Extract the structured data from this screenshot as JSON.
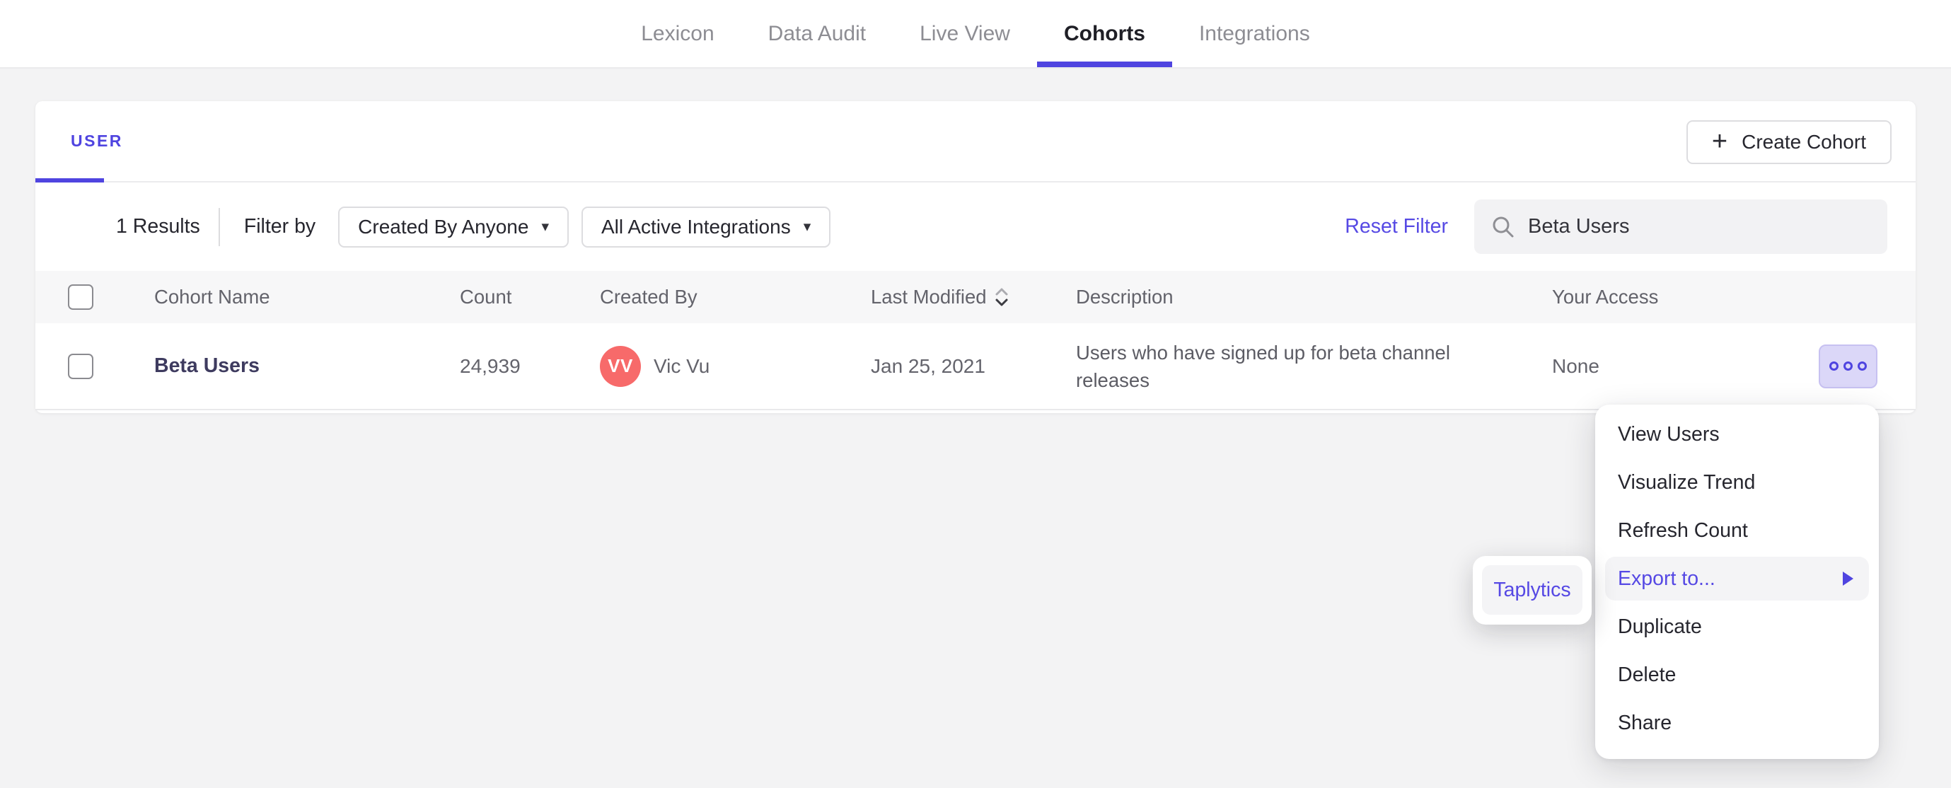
{
  "colors": {
    "accent": "#4f44e0",
    "link_purple": "#5649e4",
    "avatar_bg": "#f76a6a",
    "more_btn_bg": "#dbd7f8",
    "more_btn_border": "#c7c1f1",
    "highlight_bg": "#f4f4f6",
    "search_bg": "#f2f2f4"
  },
  "icons": {
    "plus": "+",
    "caret_down": "▾"
  },
  "nav": {
    "tabs": [
      {
        "label": "Lexicon",
        "active": false
      },
      {
        "label": "Data Audit",
        "active": false
      },
      {
        "label": "Live View",
        "active": false
      },
      {
        "label": "Cohorts",
        "active": true
      },
      {
        "label": "Integrations",
        "active": false
      }
    ]
  },
  "card": {
    "user_tab_label": "USER",
    "create_button": {
      "label": "Create Cohort"
    },
    "filters": {
      "results_count": "1 Results",
      "filter_by_label": "Filter by",
      "created_by_value": "Created By Anyone",
      "integrations_value": "All Active Integrations",
      "reset_label": "Reset Filter",
      "search_value": "Beta Users"
    },
    "table": {
      "headers": [
        "Cohort Name",
        "Count",
        "Created By",
        "Last Modified",
        "Description",
        "Your Access"
      ],
      "rows": [
        {
          "name": "Beta Users",
          "count": "24,939",
          "avatar_initials": "VV",
          "created_by": "Vic Vu",
          "last_modified": "Jan 25, 2021",
          "description": "Users who have signed up for beta channel releases",
          "access": "None"
        }
      ]
    }
  },
  "context_menu": {
    "items": [
      "View Users",
      "Visualize Trend",
      "Refresh Count",
      "Export to...",
      "Duplicate",
      "Delete",
      "Share"
    ],
    "highlighted_item": "Export to...",
    "submenu": {
      "items": [
        "Taplytics"
      ]
    }
  }
}
